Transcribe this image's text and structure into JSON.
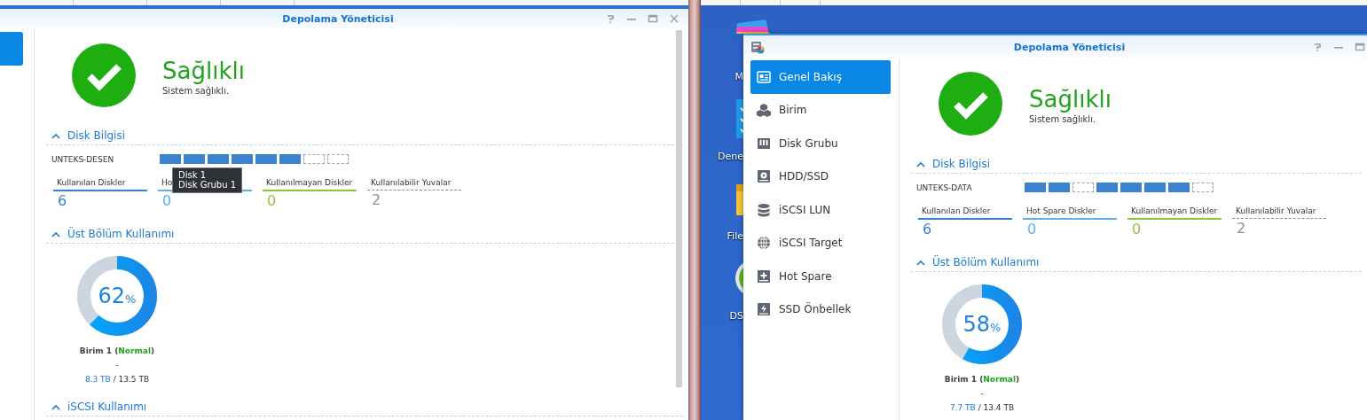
{
  "desktop_icons": [
    {
      "label": "M",
      "kind": "stack"
    },
    {
      "label": "Dene",
      "kind": "checklist"
    },
    {
      "label": "File",
      "kind": "folder"
    },
    {
      "label": "DS",
      "kind": "app"
    }
  ],
  "windows": [
    {
      "title": "Depolama Yöneticisi",
      "app_icon": false,
      "scrollbar": true,
      "controls": [
        {
          "kind": "help"
        },
        {
          "kind": "minimize"
        },
        {
          "kind": "maximize"
        },
        {
          "kind": "close"
        }
      ],
      "sidebar": [
        {
          "selected": true
        }
      ],
      "status": {
        "healthy": true,
        "title": "Sağlıklı",
        "subtitle": "Sistem sağlıklı."
      },
      "sections": [
        {
          "kind": "disks",
          "title": "Disk Bilgisi",
          "expanded": true,
          "host": "UNTEKS-DESEN",
          "slots": [
            {
              "filled": true
            },
            {
              "filled": true
            },
            {
              "filled": true
            },
            {
              "filled": true
            },
            {
              "filled": true
            },
            {
              "filled": true
            },
            {
              "filled": false
            },
            {
              "filled": false
            }
          ],
          "tooltip": {
            "lines": [
              "Disk 1",
              "Disk Grubu 1"
            ]
          },
          "stats": [
            {
              "label": "Kullanılan Diskler",
              "value": "6",
              "color": "#3b7fd4",
              "dashed": false
            },
            {
              "label": "Ho",
              "value": "0",
              "color": "#5cb0f0",
              "dashed": false
            },
            {
              "label": "Kullanılmayan Diskler",
              "value": "0",
              "color": "#8cc63e",
              "dashed": false
            },
            {
              "label": "Kullanılabilir Yuvalar",
              "value": "2",
              "color": "#8a8f96",
              "dashed": true
            }
          ]
        },
        {
          "kind": "usage",
          "title": "Üst Bölüm Kullanımı",
          "expanded": true,
          "volumes": [
            {
              "level": 0.62,
              "percent": "62",
              "unit": "%",
              "label_before": "Birim 1 (",
              "status": "Normal",
              "label_after": ")",
              "dash": "-",
              "used": "8.3 TB",
              "separator": "/",
              "total": "13.5 TB"
            }
          ]
        },
        {
          "kind": "iscsi",
          "title": "iSCSI Kullanımı",
          "expanded": true
        }
      ]
    },
    {
      "title": "Depolama Yöneticisi",
      "app_icon": true,
      "scrollbar": false,
      "controls": [
        {
          "kind": "help"
        },
        {
          "kind": "minimize"
        },
        {
          "kind": "maximize"
        }
      ],
      "sidebar": [
        {
          "label": "Genel Bakış",
          "kind": "overview",
          "selected": true
        },
        {
          "label": "Birim",
          "kind": "volume",
          "selected": false
        },
        {
          "label": "Disk Grubu",
          "kind": "diskgroup",
          "selected": false
        },
        {
          "label": "HDD/SSD",
          "kind": "hdd",
          "selected": false
        },
        {
          "label": "iSCSI LUN",
          "kind": "lun",
          "selected": false
        },
        {
          "label": "iSCSI Target",
          "kind": "target",
          "selected": false
        },
        {
          "label": "Hot Spare",
          "kind": "hotspare",
          "selected": false
        },
        {
          "label": "SSD Önbellek",
          "kind": "ssdcache",
          "selected": false
        }
      ],
      "status": {
        "healthy": true,
        "title": "Sağlıklı",
        "subtitle": "Sistem sağlıklı."
      },
      "sections": [
        {
          "kind": "disks",
          "title": "Disk Bilgisi",
          "expanded": true,
          "host": "UNTEKS-DATA",
          "slots": [
            {
              "filled": true
            },
            {
              "filled": true
            },
            {
              "filled": false
            },
            {
              "filled": true
            },
            {
              "filled": true
            },
            {
              "filled": true
            },
            {
              "filled": true
            },
            {
              "filled": false
            }
          ],
          "stats": [
            {
              "label": "Kullanılan Diskler",
              "value": "6",
              "color": "#3b7fd4",
              "dashed": false
            },
            {
              "label": "Hot Spare Diskler",
              "value": "0",
              "color": "#5cb0f0",
              "dashed": false
            },
            {
              "label": "Kullanılmayan Diskler",
              "value": "0",
              "color": "#8cc63e",
              "dashed": false
            },
            {
              "label": "Kullanılabilir Yuvalar",
              "value": "2",
              "color": "#8a8f96",
              "dashed": true
            }
          ]
        },
        {
          "kind": "usage",
          "title": "Üst Bölüm Kullanımı",
          "expanded": true,
          "volumes": [
            {
              "level": 0.58,
              "percent": "58",
              "unit": "%",
              "label_before": "Birim 1 (",
              "status": "Normal",
              "label_after": ")",
              "dash": "-",
              "used": "7.7 TB",
              "separator": "/",
              "total": "13.4 TB"
            }
          ]
        }
      ]
    }
  ]
}
